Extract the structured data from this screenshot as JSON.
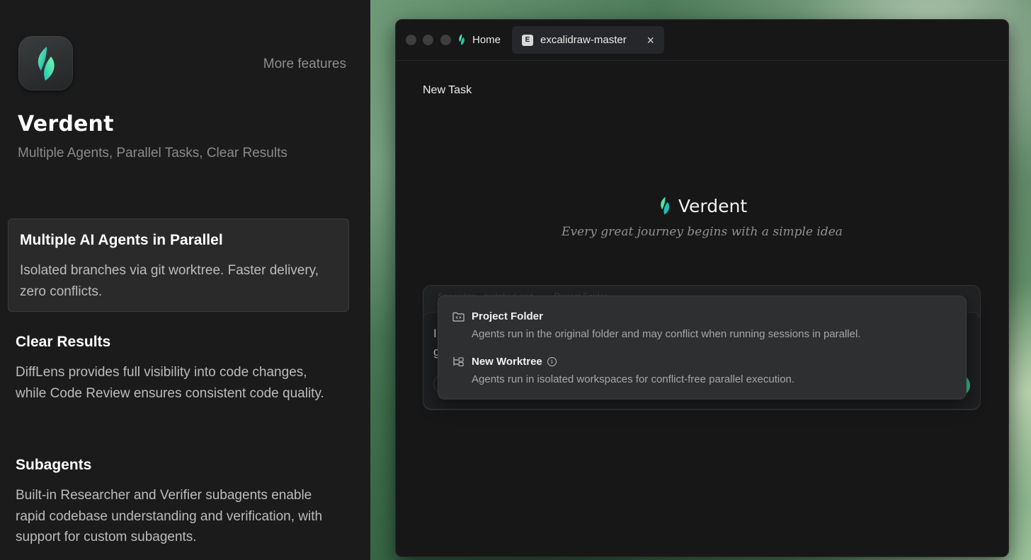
{
  "left": {
    "more_features": "More features",
    "app_name": "Verdent",
    "tagline": "Multiple Agents, Parallel Tasks, Clear Results",
    "features": [
      {
        "title": "Multiple AI Agents in Parallel",
        "desc": "Isolated branches via git worktree. Faster delivery, zero conflicts.",
        "active": true
      },
      {
        "title": "Clear Results",
        "desc": "DiffLens provides full visibility into code changes, while Code Review ensures consistent code quality.",
        "active": false
      },
      {
        "title": "Subagents",
        "desc": "Built-in Researcher and Verifier subagents enable rapid codebase understanding and verification, with support for custom subagents.",
        "active": false
      }
    ]
  },
  "window": {
    "home_tab": "Home",
    "file_tab": {
      "badge": "E",
      "label": "excalidraw-master",
      "close": "×"
    },
    "heading": "New Task",
    "brand_name": "Verdent",
    "slogan": "Every great journey begins with a simple idea",
    "composer": {
      "ghost_text": "Specialize...switched and ...      ... Project Folder",
      "line1": "I",
      "line2": "g"
    },
    "popup": {
      "options": [
        {
          "title": "Project Folder",
          "desc": "Agents run in the original folder and may conflict when running sessions in parallel.",
          "icon": "folder-code-icon"
        },
        {
          "title": "New Worktree",
          "desc": "Agents run in isolated workspaces for conflict-free parallel execution.",
          "icon": "worktree-icon",
          "info": "i"
        }
      ]
    }
  },
  "colors": {
    "accent": "#2fc28a",
    "leaf_light": "#5ef0a8",
    "leaf_dark": "#18a7b8"
  }
}
